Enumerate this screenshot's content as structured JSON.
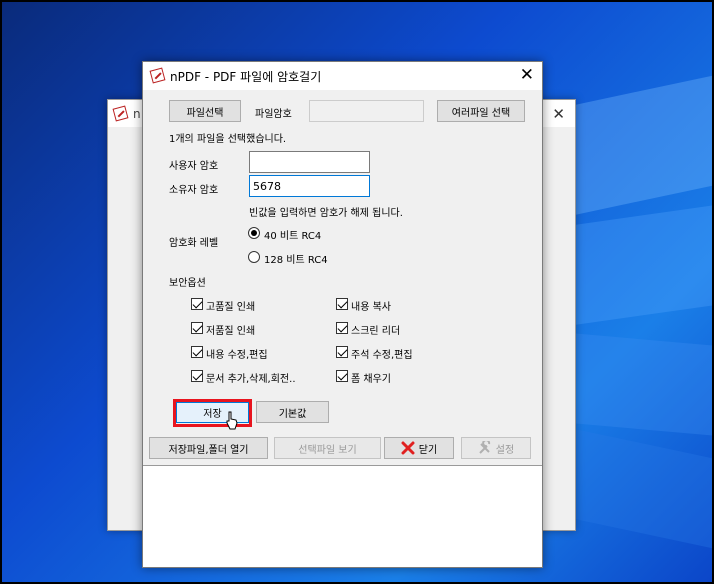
{
  "background_window": {
    "title_fragment": "n",
    "close": "✕"
  },
  "window": {
    "title": "nPDF - PDF 파일에 암호걸기",
    "close": "✕"
  },
  "top_row": {
    "select_file": "파일선택",
    "file_password_label": "파일암호",
    "file_password_value": "",
    "multi_select": "여러파일 선택"
  },
  "status": "1개의 파일을 선택했습니다.",
  "user_password": {
    "label": "사용자 암호",
    "value": ""
  },
  "owner_password": {
    "label": "소유자 암호",
    "value": "5678"
  },
  "hint": "빈값을 입력하면 암호가 해제 됩니다.",
  "encryption": {
    "label": "암호화 레벨",
    "options": [
      {
        "label": "40 비트 RC4",
        "selected": true
      },
      {
        "label": "128 비트 RC4",
        "selected": false
      }
    ]
  },
  "security": {
    "label": "보안옵션",
    "options": [
      {
        "label": "고품질 인쇄",
        "checked": true
      },
      {
        "label": "내용 복사",
        "checked": true
      },
      {
        "label": "저품질 인쇄",
        "checked": true
      },
      {
        "label": "스크린 리더",
        "checked": true
      },
      {
        "label": "내용 수정,편집",
        "checked": true
      },
      {
        "label": "주석 수정,편집",
        "checked": true
      },
      {
        "label": "문서 추가,삭제,회전..",
        "checked": true
      },
      {
        "label": "폼 채우기",
        "checked": true
      }
    ]
  },
  "buttons": {
    "save": "저장",
    "default": "기본값",
    "open_folder": "저장파일,폴더 열기",
    "view_selected": "선택파일 보기",
    "close": "닫기",
    "settings": "설정"
  },
  "colors": {
    "highlight": "#e8141e",
    "close_icon": "#e02020"
  }
}
